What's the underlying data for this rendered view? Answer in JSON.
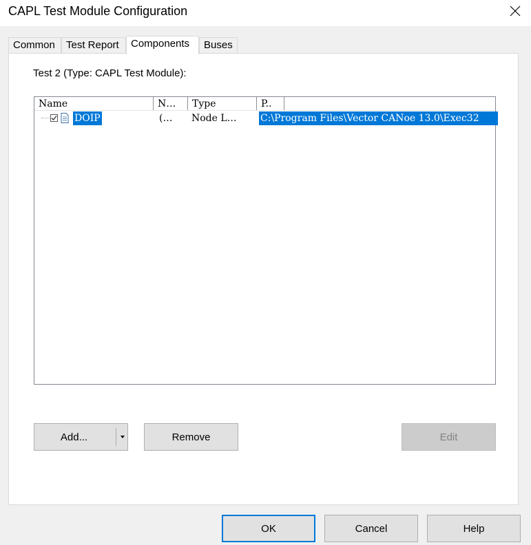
{
  "window": {
    "title": "CAPL Test Module Configuration"
  },
  "tabs": [
    {
      "label": "Common"
    },
    {
      "label": "Test Report"
    },
    {
      "label": "Components"
    },
    {
      "label": "Buses"
    }
  ],
  "panel": {
    "test_label": "Test 2 (Type: CAPL Test Module):"
  },
  "list": {
    "columns": [
      "Name",
      "N…",
      "Type",
      "P.."
    ],
    "rows": [
      {
        "name": "DOIP",
        "n": "(…",
        "type": "Node L…",
        "path": "C:\\Program Files\\Vector CANoe 13.0\\Exec32",
        "checked": true
      }
    ]
  },
  "buttons": {
    "add": "Add...",
    "remove": "Remove",
    "edit": "Edit",
    "ok": "OK",
    "cancel": "Cancel",
    "help": "Help"
  },
  "colors": {
    "selection": "#0078d7",
    "default_border": "#0078d7"
  },
  "icons": {
    "close": "close-icon",
    "document": "document-icon",
    "dropdown": "chevron-down-icon"
  }
}
